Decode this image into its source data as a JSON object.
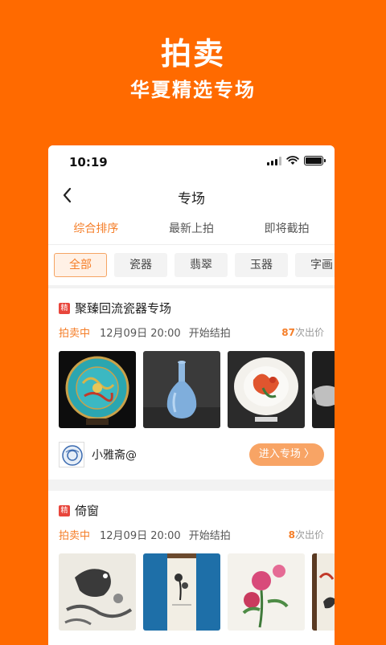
{
  "promo": {
    "title": "拍卖",
    "subtitle": "华夏精选专场"
  },
  "status_bar": {
    "time": "10:19"
  },
  "nav": {
    "title": "专场",
    "back_icon": "chevron-left-icon"
  },
  "sort_tabs": [
    {
      "label": "综合排序",
      "active": true
    },
    {
      "label": "最新上拍",
      "active": false
    },
    {
      "label": "即将截拍",
      "active": false
    }
  ],
  "categories": [
    {
      "label": "全部",
      "active": true
    },
    {
      "label": "瓷器",
      "active": false
    },
    {
      "label": "翡翠",
      "active": false
    },
    {
      "label": "玉器",
      "active": false
    },
    {
      "label": "字画",
      "active": false
    }
  ],
  "auctions": [
    {
      "badge": "精",
      "title": "聚臻回流瓷器专场",
      "status": "拍卖中",
      "date": "12月09日 20:00",
      "end_text": "开始结拍",
      "bid_count": "87",
      "bid_suffix": "次出价",
      "shop_name": "小雅斋@",
      "enter_label": "进入专场 〉"
    },
    {
      "badge": "精",
      "title": "倚窗",
      "status": "拍卖中",
      "date": "12月09日 20:00",
      "end_text": "开始结拍",
      "bid_count": "8",
      "bid_suffix": "次出价"
    }
  ],
  "colors": {
    "brand": "#FF6A00",
    "accent": "#F57E28",
    "button": "#F8A465",
    "badge": "#E8463C"
  }
}
